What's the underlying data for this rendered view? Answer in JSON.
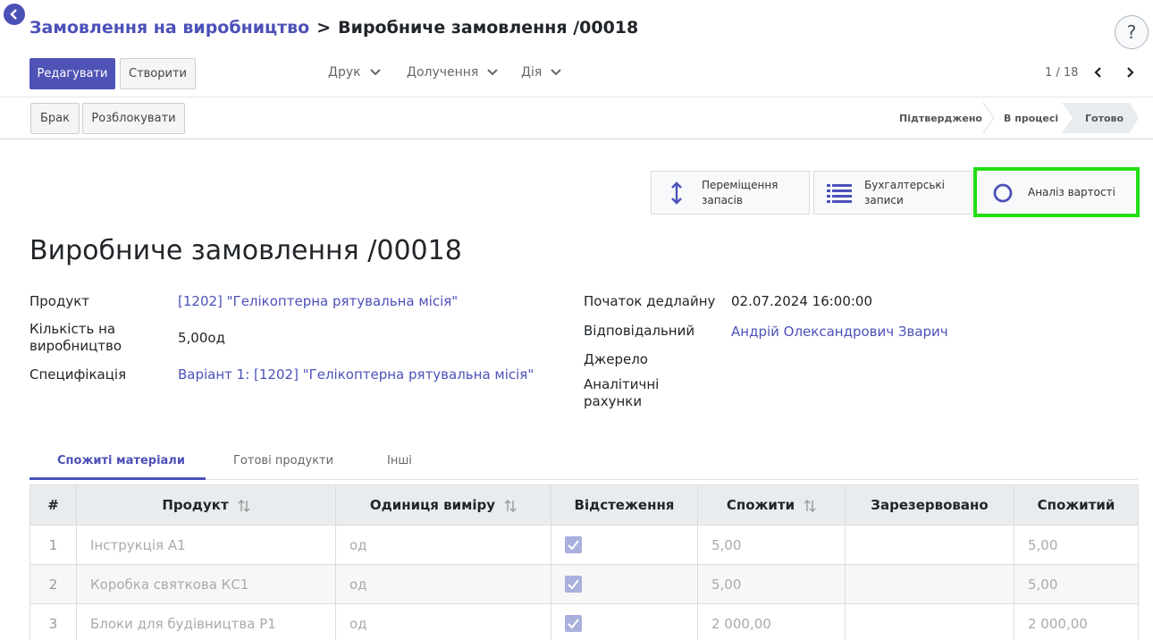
{
  "breadcrumb": {
    "parent": "Замовлення на виробництво",
    "separator": ">",
    "current": "Виробниче замовлення /00018"
  },
  "toolbar": {
    "edit_label": "Редагувати",
    "create_label": "Створити",
    "print_label": "Друк",
    "attach_label": "Долучення",
    "action_label": "Дія",
    "pager": "1 / 18"
  },
  "help_label": "?",
  "statusbar": {
    "scrap_label": "Брак",
    "unlock_label": "Розблокувати",
    "states": [
      "Підтверджено",
      "В процесі",
      "Готово"
    ]
  },
  "smart_buttons": {
    "stock_moves_line1": "Переміщення",
    "stock_moves_line2": "запасів",
    "accounting_line1": "Бухгалтерські",
    "accounting_line2": "записи",
    "cost_analysis": "Аналіз вартості"
  },
  "record": {
    "title": "Виробниче замовлення /00018",
    "product_label": "Продукт",
    "product_value": "[1202] \"Гелікоптерна рятувальна місія\"",
    "qty_label_1": "Кількість на",
    "qty_label_2": "виробництво",
    "qty_value": "5,00од",
    "bom_label": "Специфікація",
    "bom_value": "Варіант 1: [1202] \"Гелікоптерна рятувальна місія\"",
    "deadline_label": "Початок дедлайну",
    "deadline_value": "02.07.2024 16:00:00",
    "responsible_label": "Відповідальний",
    "responsible_value": "Андрій Олександрович Зварич",
    "source_label": "Джерело",
    "analytic_label_1": "Аналітичні",
    "analytic_label_2": "рахунки"
  },
  "tabs": [
    "Спожиті матеріали",
    "Готові продукти",
    "Інші"
  ],
  "table": {
    "headers": [
      "#",
      "Продукт",
      "Одиниця виміру",
      "Відстеження",
      "Спожити",
      "Зарезервовано",
      "Спожитий"
    ],
    "rows": [
      {
        "num": "1",
        "product": "Інструкція А1",
        "uom": "од",
        "consume": "5,00",
        "reserved": "",
        "consumed": "5,00"
      },
      {
        "num": "2",
        "product": "Коробка святкова КС1",
        "uom": "од",
        "consume": "5,00",
        "reserved": "",
        "consumed": "5,00"
      },
      {
        "num": "3",
        "product": "Блоки для будівництва Р1",
        "uom": "од",
        "consume": "2 000,00",
        "reserved": "",
        "consumed": "2 000,00"
      }
    ]
  },
  "colors": {
    "accent": "#4c51b8",
    "highlight": "#22dd11"
  }
}
